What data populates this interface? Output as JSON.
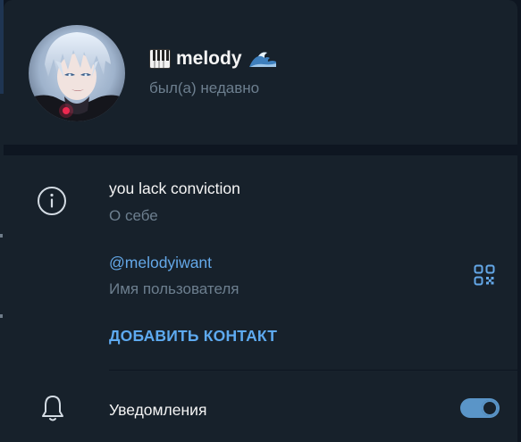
{
  "profile": {
    "name": "melody",
    "name_prefix_icon": "piano-emoji",
    "name_suffix_icon": "wave-emoji",
    "status": "был(а) недавно",
    "avatar_icon": "anime-avatar"
  },
  "info": {
    "bio": "you lack conviction",
    "bio_label": "О себе",
    "username": "@melodyiwant",
    "username_label": "Имя пользователя",
    "add_contact": "ДОБАВИТЬ КОНТАКТ"
  },
  "notifications": {
    "label": "Уведомления",
    "enabled": true
  },
  "colors": {
    "background": "#17212b",
    "accent": "#64a8e8",
    "toggle": "#5a95c8",
    "secondary_text": "#6d7f8f"
  }
}
